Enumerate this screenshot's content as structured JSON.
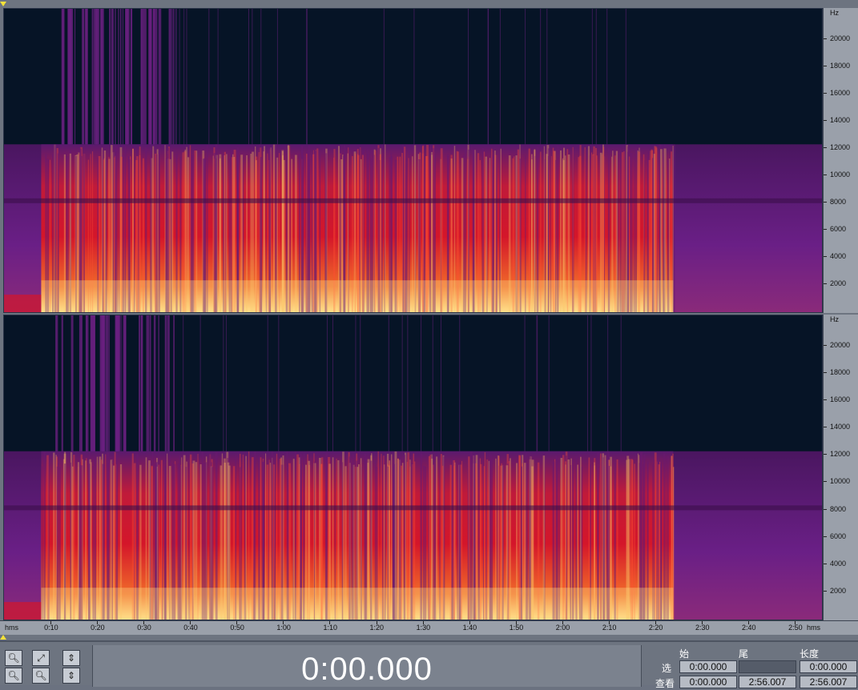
{
  "freq_axis": {
    "unit": "Hz",
    "ticks": [
      "20000",
      "18000",
      "16000",
      "14000",
      "12000",
      "10000",
      "8000",
      "6000",
      "4000",
      "2000"
    ],
    "max_hz": 22050
  },
  "time_axis": {
    "unit_label": "hms",
    "ticks": [
      "0:10",
      "0:20",
      "0:30",
      "0:40",
      "0:50",
      "1:00",
      "1:10",
      "1:20",
      "1:30",
      "1:40",
      "1:50",
      "2:00",
      "2:10",
      "2:20",
      "2:30",
      "2:40",
      "2:50"
    ],
    "duration_s": 176.007
  },
  "colors": {
    "background": "#061426",
    "low": "#5a1a6e",
    "mid": "#d4162a",
    "high": "#ffe08a",
    "marker": "#f4e23a"
  },
  "transport": {
    "current_time": "0:00.000"
  },
  "zoom_buttons": [
    {
      "name": "zoom-out-icon",
      "glyph": "🔍︎"
    },
    {
      "name": "zoom-full-icon",
      "glyph": "⤢"
    },
    {
      "name": "zoom-in-vertical-icon",
      "glyph": "⇕"
    },
    {
      "name": "zoom-in-icon",
      "glyph": "🔍︎"
    },
    {
      "name": "zoom-selection-icon",
      "glyph": "🔍︎"
    },
    {
      "name": "zoom-out-vertical-icon",
      "glyph": "⇕"
    }
  ],
  "selection_panel": {
    "headers": {
      "start": "始",
      "end": "尾",
      "length": "长度"
    },
    "selection": {
      "label": "选",
      "start": "0:00.000",
      "end": "",
      "length": "0:00.000"
    },
    "view": {
      "label": "查看",
      "start": "0:00.000",
      "end": "2:56.007",
      "length": "2:56.007"
    }
  }
}
